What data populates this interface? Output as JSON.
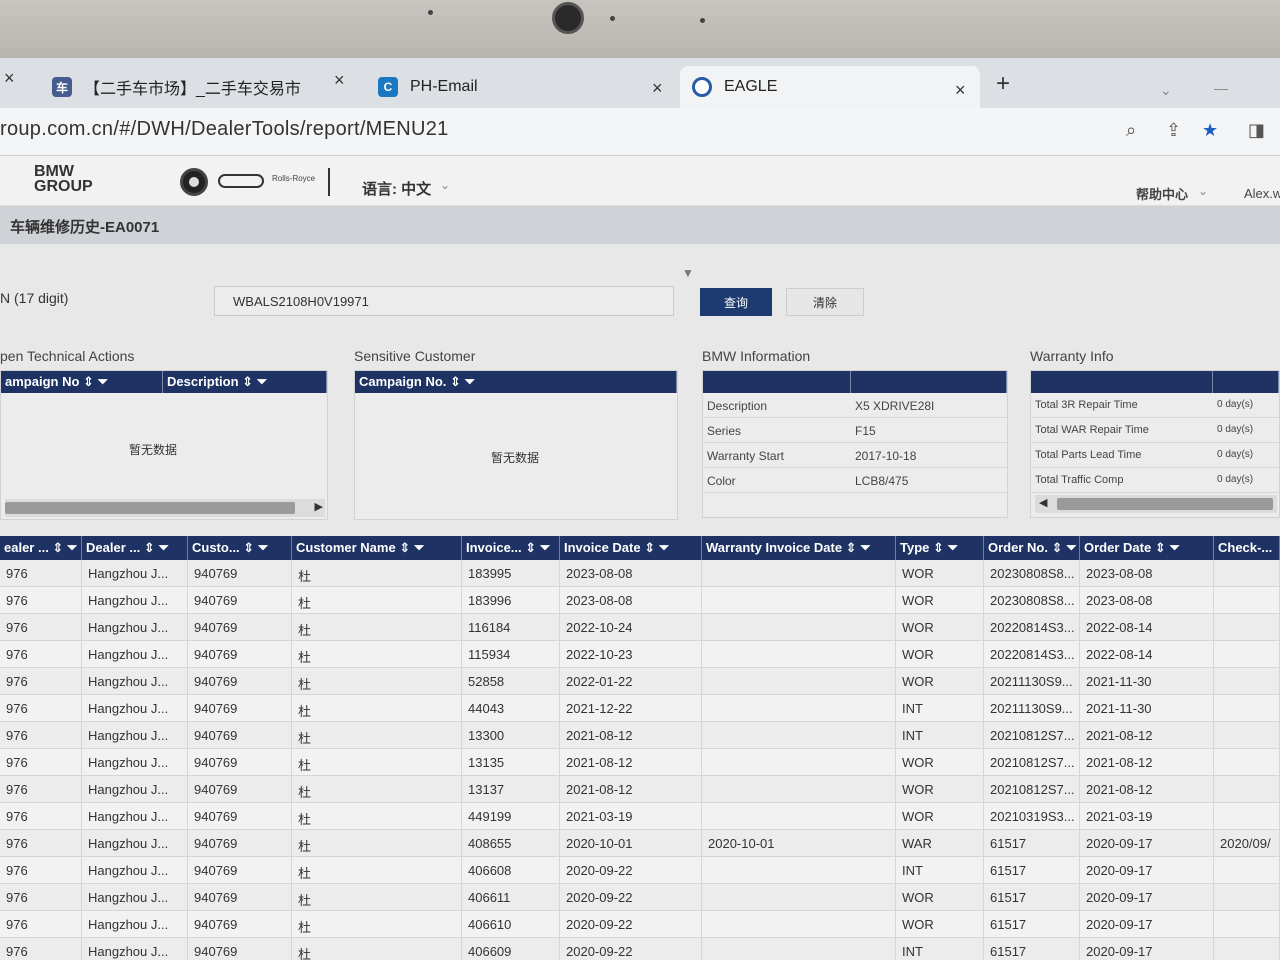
{
  "browser": {
    "tabs": [
      {
        "title": "【二手车市场】_二手车交易市"
      },
      {
        "title": "PH-Email"
      },
      {
        "title": "EAGLE"
      }
    ],
    "url": "roup.com.cn/#/DWH/DealerTools/report/MENU21"
  },
  "header": {
    "logo": "BMW GROUP",
    "language": "语言: 中文",
    "help": "帮助中心",
    "user": "Alex.w"
  },
  "page": {
    "title": "车辆维修历史-EA0071"
  },
  "search": {
    "label": "N (17 digit)",
    "value": "WBALS2108H0V19971",
    "query_button": "查询",
    "clear_button": "清除"
  },
  "panels": {
    "open_actions": {
      "title": "pen Technical Actions",
      "columns": [
        "ampaign No",
        "Description"
      ],
      "empty": "暂无数据"
    },
    "sensitive": {
      "title": "Sensitive Customer",
      "columns": [
        "Campaign No."
      ],
      "empty": "暂无数据"
    },
    "bmw_info": {
      "title": "BMW Information",
      "rows": [
        {
          "label": "Description",
          "value": "X5 XDRIVE28I"
        },
        {
          "label": "Series",
          "value": "F15"
        },
        {
          "label": "Warranty Start",
          "value": "2017-10-18"
        },
        {
          "label": "Color",
          "value": "LCB8/475"
        }
      ]
    },
    "warranty": {
      "title": "Warranty Info",
      "rows": [
        {
          "label": "Total 3R Repair Time",
          "value": "0 day(s)"
        },
        {
          "label": "Total WAR Repair Time",
          "value": "0 day(s)"
        },
        {
          "label": "Total Parts Lead Time",
          "value": "0 day(s)"
        },
        {
          "label": "Total Traffic Comp",
          "value": "0 day(s)"
        }
      ]
    }
  },
  "table": {
    "columns": [
      "ealer ...",
      "Dealer ...",
      "Custo...",
      "Customer Name",
      "Invoice...",
      "Invoice Date",
      "Warranty Invoice Date",
      "Type",
      "Order No.",
      "Order Date",
      "Check-..."
    ],
    "rows": [
      [
        "976",
        "Hangzhou J...",
        "940769",
        "杜",
        "183995",
        "2023-08-08",
        "",
        "WOR",
        "20230808S8...",
        "2023-08-08",
        ""
      ],
      [
        "976",
        "Hangzhou J...",
        "940769",
        "杜",
        "183996",
        "2023-08-08",
        "",
        "WOR",
        "20230808S8...",
        "2023-08-08",
        ""
      ],
      [
        "976",
        "Hangzhou J...",
        "940769",
        "杜",
        "116184",
        "2022-10-24",
        "",
        "WOR",
        "20220814S3...",
        "2022-08-14",
        ""
      ],
      [
        "976",
        "Hangzhou J...",
        "940769",
        "杜",
        "115934",
        "2022-10-23",
        "",
        "WOR",
        "20220814S3...",
        "2022-08-14",
        ""
      ],
      [
        "976",
        "Hangzhou J...",
        "940769",
        "杜",
        "52858",
        "2022-01-22",
        "",
        "WOR",
        "20211130S9...",
        "2021-11-30",
        ""
      ],
      [
        "976",
        "Hangzhou J...",
        "940769",
        "杜",
        "44043",
        "2021-12-22",
        "",
        "INT",
        "20211130S9...",
        "2021-11-30",
        ""
      ],
      [
        "976",
        "Hangzhou J...",
        "940769",
        "杜",
        "13300",
        "2021-08-12",
        "",
        "INT",
        "20210812S7...",
        "2021-08-12",
        ""
      ],
      [
        "976",
        "Hangzhou J...",
        "940769",
        "杜",
        "13135",
        "2021-08-12",
        "",
        "WOR",
        "20210812S7...",
        "2021-08-12",
        ""
      ],
      [
        "976",
        "Hangzhou J...",
        "940769",
        "杜",
        "13137",
        "2021-08-12",
        "",
        "WOR",
        "20210812S7...",
        "2021-08-12",
        ""
      ],
      [
        "976",
        "Hangzhou J...",
        "940769",
        "杜",
        "449199",
        "2021-03-19",
        "",
        "WOR",
        "20210319S3...",
        "2021-03-19",
        ""
      ],
      [
        "976",
        "Hangzhou J...",
        "940769",
        "杜",
        "408655",
        "2020-10-01",
        "2020-10-01",
        "WAR",
        "61517",
        "2020-09-17",
        "2020/09/"
      ],
      [
        "976",
        "Hangzhou J...",
        "940769",
        "杜",
        "406608",
        "2020-09-22",
        "",
        "INT",
        "61517",
        "2020-09-17",
        ""
      ],
      [
        "976",
        "Hangzhou J...",
        "940769",
        "杜",
        "406611",
        "2020-09-22",
        "",
        "WOR",
        "61517",
        "2020-09-17",
        ""
      ],
      [
        "976",
        "Hangzhou J...",
        "940769",
        "杜",
        "406610",
        "2020-09-22",
        "",
        "WOR",
        "61517",
        "2020-09-17",
        ""
      ],
      [
        "976",
        "Hangzhou J...",
        "940769",
        "杜",
        "406609",
        "2020-09-22",
        "",
        "INT",
        "61517",
        "2020-09-17",
        ""
      ]
    ]
  },
  "icons": {
    "close": "×",
    "new_tab": "+",
    "sort": "⇕",
    "filter": "funnel-icon"
  }
}
